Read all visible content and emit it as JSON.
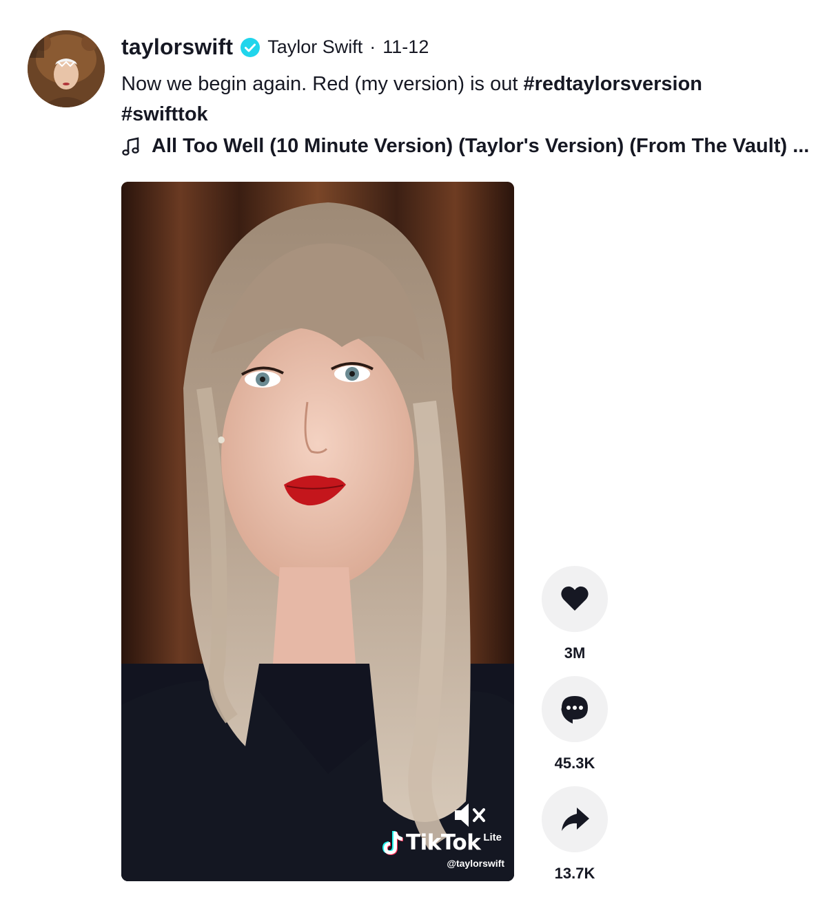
{
  "author": {
    "username": "taylorswift",
    "nickname": "Taylor Swift",
    "separator": "·",
    "date": "11-12",
    "verified": true
  },
  "caption": {
    "text": "Now we begin again. Red (my version) is out ",
    "hashtags": [
      "#redtaylorsversion",
      "#swifttok"
    ]
  },
  "music": {
    "icon": "music-note-icon",
    "title": "All Too Well (10 Minute Version) (Taylor's Version) (From The Vault) ..."
  },
  "video": {
    "watermark_brand": "TikTok",
    "watermark_tag": "Lite",
    "watermark_handle": "@taylorswift",
    "muted": true
  },
  "actions": [
    {
      "name": "like",
      "icon": "heart-icon",
      "count": "3M"
    },
    {
      "name": "comment",
      "icon": "comment-icon",
      "count": "45.3K"
    },
    {
      "name": "share",
      "icon": "share-icon",
      "count": "13.7K"
    }
  ],
  "colors": {
    "verified_badge": "#20d5ec",
    "action_bg": "#f1f1f2",
    "text": "#161823"
  }
}
